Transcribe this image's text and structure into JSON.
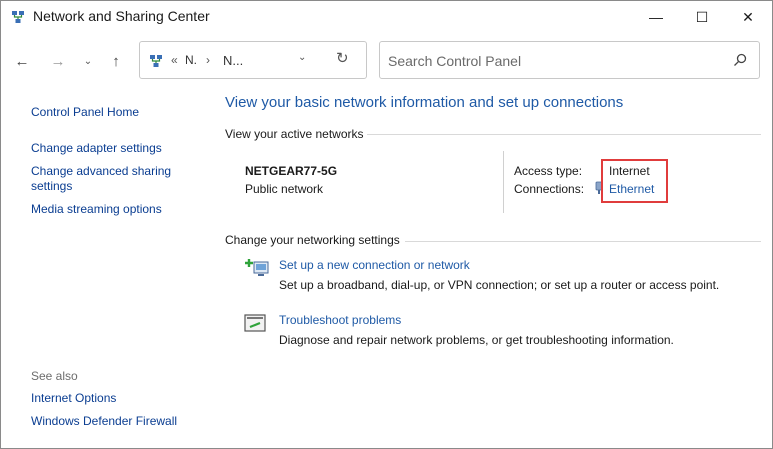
{
  "window": {
    "title": "Network and Sharing Center",
    "controls": {
      "minimize": "—",
      "maximize": "☐",
      "close": "✕"
    }
  },
  "nav": {
    "back": "←",
    "forward": "→",
    "recent": "⌄",
    "up": "↑",
    "address": {
      "chevrons": "«",
      "crumb1": "N.",
      "separator": "›",
      "crumb2": "N...",
      "dropdown": "⌄",
      "refresh": "↻"
    },
    "search": {
      "placeholder": "Search Control Panel",
      "value": ""
    }
  },
  "sidebar": {
    "home": "Control Panel Home",
    "items": [
      "Change adapter settings",
      "Change advanced sharing",
      "settings",
      "Media streaming options"
    ],
    "see_also_heading": "See also",
    "see_also": [
      "Internet Options",
      "Windows Defender Firewall"
    ]
  },
  "main": {
    "title": "View your basic network information and set up connections",
    "active_networks_heading": "View your active networks",
    "network": {
      "name": "NETGEAR77-5G",
      "type": "Public network",
      "access_type_label": "Access type:",
      "access_type_value": "Internet",
      "connections_label": "Connections:",
      "connections_value": "Ethernet"
    },
    "settings_heading": "Change your networking settings",
    "tasks": [
      {
        "link": "Set up a new connection or network",
        "desc": "Set up a broadband, dial-up, or VPN connection; or set up a router or access point.",
        "icon": "new-connection-icon"
      },
      {
        "link": "Troubleshoot problems",
        "desc": "Diagnose and repair network problems, or get troubleshooting information.",
        "icon": "troubleshoot-icon"
      }
    ]
  },
  "colors": {
    "link": "#1f5aa6",
    "highlight": "#e03c3c",
    "sidebar_link": "#0a3d91"
  }
}
